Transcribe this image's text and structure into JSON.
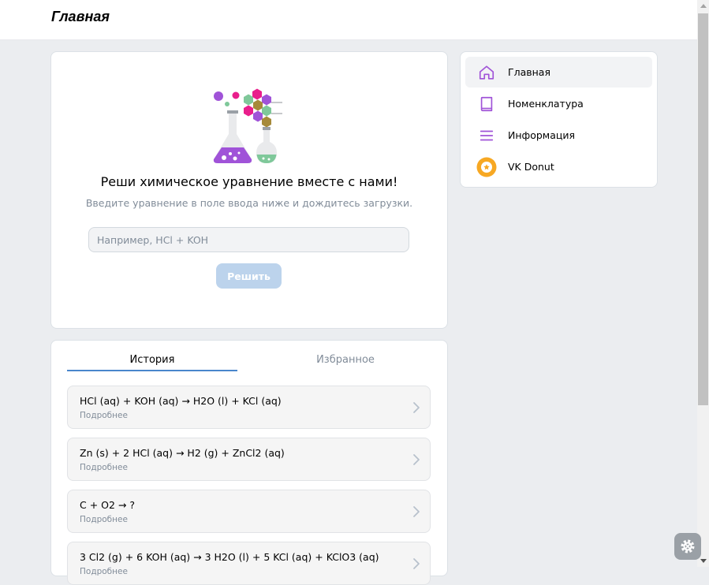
{
  "header": {
    "title": "Главная"
  },
  "solver": {
    "headline": "Реши химическое уравнение вместе с нами!",
    "subline": "Введите уравнение в поле ввода ниже и дождитесь загрузки.",
    "input_placeholder": "Например, HCl + KOH",
    "solve_label": "Решить"
  },
  "nav": {
    "items": [
      {
        "label": "Главная",
        "icon": "home-icon",
        "active": true
      },
      {
        "label": "Номенклатура",
        "icon": "book-icon",
        "active": false
      },
      {
        "label": "Информация",
        "icon": "menu-icon",
        "active": false
      },
      {
        "label": "VK Donut",
        "icon": "donut-icon",
        "active": false
      }
    ]
  },
  "history": {
    "tabs": [
      "История",
      "Избранное"
    ],
    "active_tab": "История",
    "items": [
      {
        "equation": "HCl (aq) + KOH (aq) → H2O (l) + KCl (aq)",
        "more": "Подробнее"
      },
      {
        "equation": "Zn (s) + 2 HCl (aq) → H2 (g) + ZnCl2 (aq)",
        "more": "Подробнее"
      },
      {
        "equation": "C + O2 → ?",
        "more": "Подробнее"
      },
      {
        "equation": "3 Cl2 (g) + 6 KOH (aq) → 3 H2O (l) + 5 KCl (aq) + KClO3 (aq)",
        "more": "Подробнее"
      }
    ]
  },
  "colors": {
    "accent": "#4986cc",
    "nav_icon": "#a053d8",
    "button_disabled": "#bcd3ec",
    "donut": "#f7a823"
  }
}
